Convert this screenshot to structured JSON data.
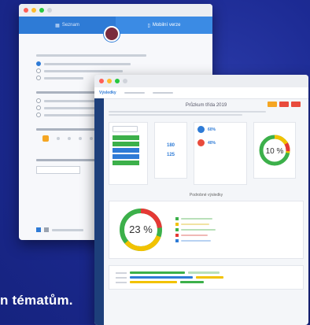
{
  "caption": "n tématům.",
  "back_window": {
    "tabs": [
      {
        "label": "Seznam"
      },
      {
        "label": "Mobilní verze"
      }
    ]
  },
  "front_window": {
    "nav_tabs": [
      {
        "label": "Výsledky"
      }
    ],
    "page_title": "Průzkum třída 2019",
    "section_title": "Podrobné výsledky",
    "stats": [
      {
        "value": "180"
      },
      {
        "value": "125"
      }
    ],
    "people": [
      {
        "value": "60%"
      },
      {
        "value": "40%"
      }
    ],
    "donut_small": {
      "value": 10,
      "label": "10 %"
    },
    "donut_big": {
      "value": 23,
      "label": "23 %"
    }
  },
  "colors": {
    "accent": "#2e7bd6",
    "donut_red": "#e53935",
    "donut_yellow": "#f2c200",
    "donut_green": "#3cb04a",
    "donut_blue": "#2e7bd6"
  }
}
